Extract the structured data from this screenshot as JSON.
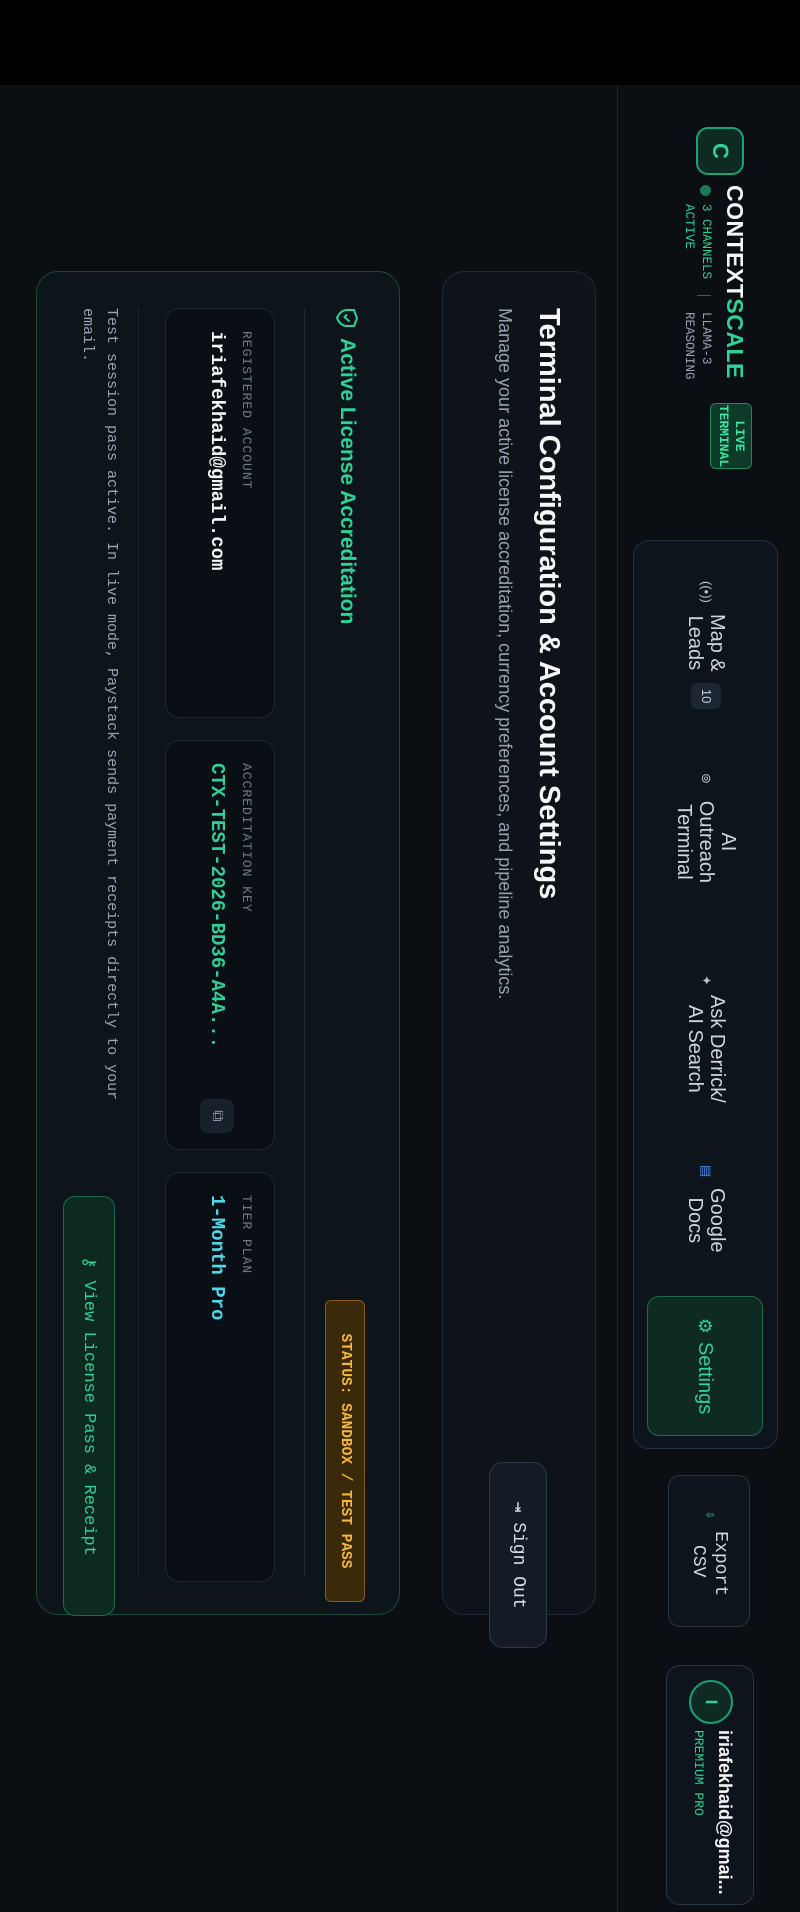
{
  "header": {
    "logo_letter": "C",
    "brand_main": "CONTEXT",
    "brand_accent": "SCALE",
    "live_badge_line1": "LIVE",
    "live_badge_line2": "TERMINAL",
    "channels_line1": "3 CHANNELS",
    "channels_line2": "ACTIVE",
    "model_line1": "LLAMA-3",
    "model_line2": "REASONING"
  },
  "nav": {
    "items": [
      {
        "label": "Map & Leads",
        "icon": "signal-icon",
        "badge": "10"
      },
      {
        "label": "AI Outreach Terminal",
        "icon": "bot-icon"
      },
      {
        "label": "Ask Derrick/ AI Search",
        "icon": "spark-icon"
      },
      {
        "label": "Google Docs",
        "icon": "doc-icon"
      },
      {
        "label": "Settings",
        "icon": "gear-icon"
      }
    ],
    "active": "Settings"
  },
  "toolbar": {
    "export_label": "Export CSV"
  },
  "user": {
    "initial": "I",
    "email": "iriafekhaid@gmai...",
    "plan": "PREMIUM PRO"
  },
  "settings": {
    "title": "Terminal Configuration & Account Settings",
    "subtitle": "Manage your active license accreditation, currency preferences, and pipeline analytics.",
    "signout_label": "Sign Out"
  },
  "license": {
    "heading": "Active License Accreditation",
    "status": "STATUS: SANDBOX / TEST PASS",
    "fields": [
      {
        "label": "REGISTERED ACCOUNT",
        "value": "iriafekhaid@gmail.com"
      },
      {
        "label": "ACCREDITATION KEY",
        "value": "CTX-TEST-2026-BD36-A4A..."
      },
      {
        "label": "TIER PLAN",
        "value": "1-Month Pro"
      }
    ],
    "note": "Test session pass active. In live mode, Paystack sends payment receipts directly to your email.",
    "view_pass_label": "View License Pass & Receipt"
  },
  "colors": {
    "accent": "#2ed198",
    "warning": "#f5b740",
    "background": "#0b0e13",
    "tier": "#4fd8e8"
  }
}
